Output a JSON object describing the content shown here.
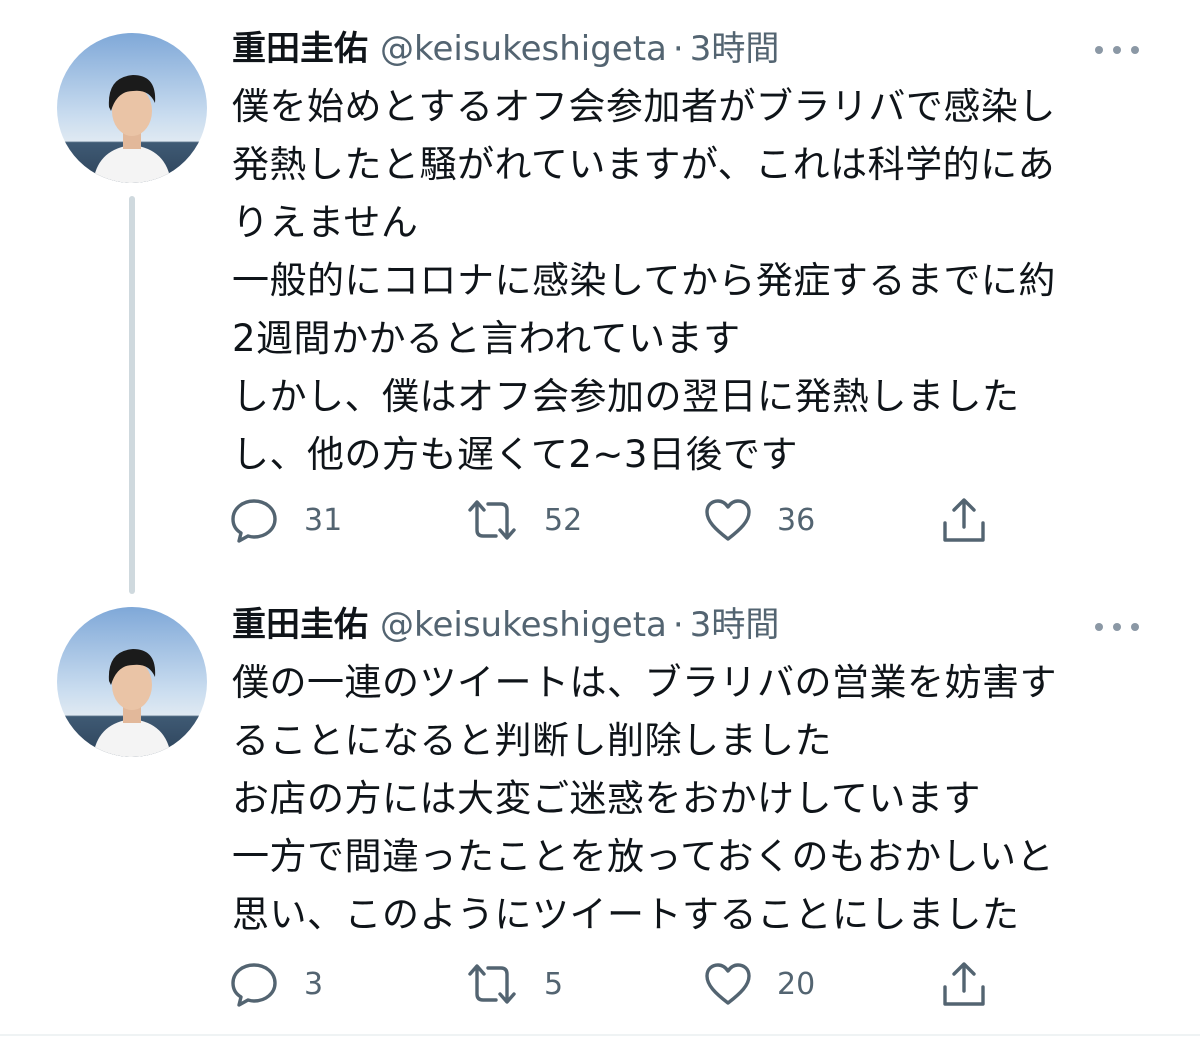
{
  "tweets": [
    {
      "name": "重田圭佑",
      "handle": "@keisukeshigeta",
      "separator": "·",
      "time": "3時間",
      "lines": [
        "僕を始めとするオフ会参加者がブラリバで感染し",
        "発熱したと騒がれていますが、これは科学的にあ",
        "りえません",
        "一般的にコロナに感染してから発症するまでに約",
        "2週間かかると言われています",
        "しかし、僕はオフ会参加の翌日に発熱しました",
        "し、他の方も遅くて2~3日後です"
      ],
      "replies": "31",
      "retweets": "52",
      "likes": "36"
    },
    {
      "name": "重田圭佑",
      "handle": "@keisukeshigeta",
      "separator": "·",
      "time": "3時間",
      "lines": [
        "僕の一連のツイートは、ブラリバの営業を妨害す",
        "ることになると判断し削除しました",
        "お店の方には大変ご迷惑をおかけしています",
        "一方で間違ったことを放っておくのもおかしいと",
        "思い、このようにツイートすることにしました"
      ],
      "replies": "3",
      "retweets": "5",
      "likes": "20"
    }
  ],
  "icons": {
    "reply": "speech-bubble-icon",
    "retweet": "retweet-arrows-icon",
    "like": "heart-icon",
    "share": "share-upload-icon",
    "more": "ellipsis-icon"
  },
  "colors": {
    "text": "#0f1419",
    "secondary": "#536471",
    "thread_line": "#cfd9de"
  }
}
